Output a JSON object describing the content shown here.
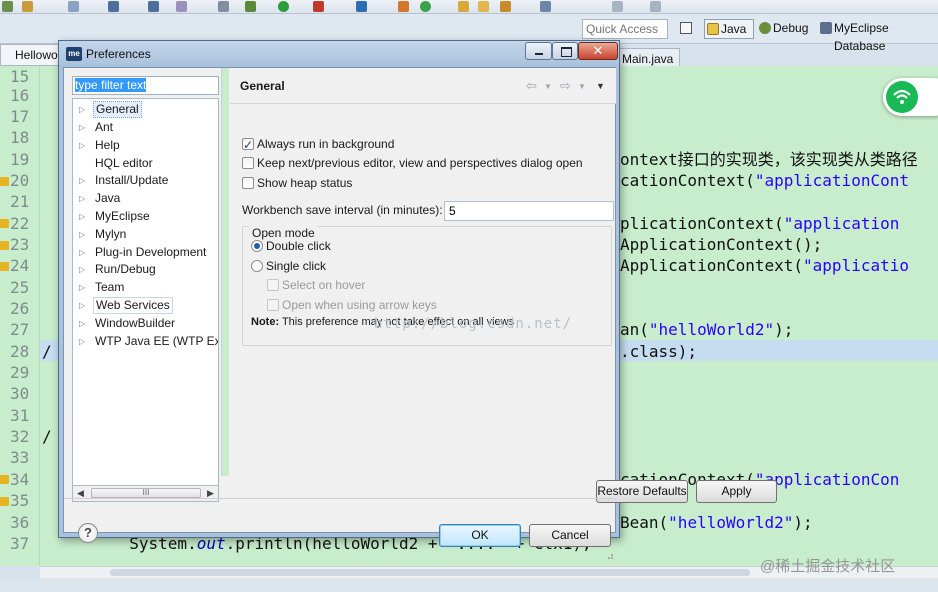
{
  "ide": {
    "quick_access_placeholder": "Quick Access",
    "perspectives": [
      "Java",
      "Debug",
      "MyEclipse Database"
    ],
    "left_tab_label": "Hellowo",
    "main_tab_label": "Main.java",
    "line_numbers": [
      "15",
      "16",
      "17",
      "18",
      "19",
      "20",
      "21",
      "22",
      "23",
      "24",
      "25",
      "26",
      "27",
      "28",
      "29",
      "30",
      "31",
      "32",
      "33",
      "34",
      "35",
      "36",
      "37"
    ],
    "code_lines": {
      "l19": "ontext接口的实现类，该实现类从类路径",
      "l20_a": "cationContext(",
      "l20_b": "\"applicationCont",
      "l22_a": "plicationContext(",
      "l22_b": "\"application",
      "l23": "ApplicationContext();",
      "l24_a": "ApplicationContext(",
      "l24_b": "\"applicatio",
      "l27_a": "an(",
      "l27_b": "\"helloWorld2\"",
      "l27_c": ");",
      "l28": ".class);",
      "l28_prefix": "/",
      "l32_prefix": "/",
      "l34_a": "cationContext(",
      "l34_b": "\"applicationCon",
      "l36_a": "Bean(",
      "l36_b": "\"helloWorld2\"",
      "l36_c": ");",
      "l37_a": "  System.",
      "l37_b": "out",
      "l37_c": ".println(helloWorld2 + \"....\" + ctx1);"
    },
    "watermark": "@稀土掘金技术社区"
  },
  "dialog": {
    "title": "Preferences",
    "app_icon": "me",
    "filter_placeholder": "type filter text",
    "tree_items": [
      {
        "label": "General",
        "arrow": "▷",
        "selected": true
      },
      {
        "label": "Ant",
        "arrow": "▷"
      },
      {
        "label": "Help",
        "arrow": "▷"
      },
      {
        "label": "HQL editor",
        "arrow": ""
      },
      {
        "label": "Install/Update",
        "arrow": "▷"
      },
      {
        "label": "Java",
        "arrow": "▷"
      },
      {
        "label": "MyEclipse",
        "arrow": "▷"
      },
      {
        "label": "Mylyn",
        "arrow": "▷"
      },
      {
        "label": "Plug-in Development",
        "arrow": "▷"
      },
      {
        "label": "Run/Debug",
        "arrow": "▷"
      },
      {
        "label": "Team",
        "arrow": "▷"
      },
      {
        "label": "Web Services",
        "arrow": "▷"
      },
      {
        "label": "WindowBuilder",
        "arrow": "▷"
      },
      {
        "label": "WTP Java EE (WTP Extras)",
        "arrow": "▷"
      }
    ],
    "scroll_thumb_label": "III",
    "page": {
      "title": "General",
      "always_background": {
        "label": "Always run in background",
        "checked": true
      },
      "keep_next_prev": {
        "label": "Keep next/previous editor, view and perspectives dialog open",
        "checked": false
      },
      "show_heap": {
        "label": "Show heap status",
        "checked": false
      },
      "interval_label": "Workbench save interval (in minutes):",
      "interval_value": "5",
      "open_mode": {
        "legend": "Open mode",
        "double_click": "Double click",
        "single_click": "Single click",
        "select_on_hover": "Select on hover",
        "open_arrow_keys": "Open when using arrow keys",
        "selected": "double_click",
        "note_bold": "Note:",
        "note_text": " This preference may not take effect on all views"
      },
      "watermark": "http://blog.csdn.net/"
    },
    "buttons": {
      "restore_defaults": "Restore Defaults",
      "apply": "Apply",
      "ok": "OK",
      "cancel": "Cancel",
      "help": "?"
    }
  }
}
